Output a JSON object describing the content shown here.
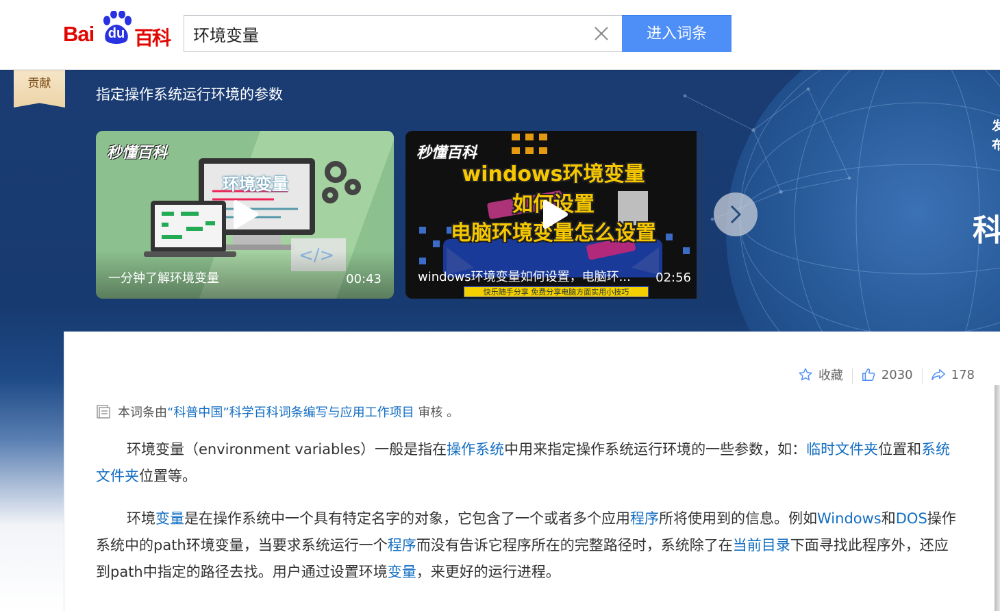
{
  "header": {
    "logo_text": "Bai du 百科",
    "search": {
      "value": "环境变量",
      "placeholder": ""
    },
    "enter_label": "进入词条"
  },
  "hero": {
    "contrib_label": "贡献",
    "subtitle": "指定操作系统运行环境的参数",
    "side_text": [
      "发",
      "布",
      "科"
    ],
    "videos": [
      {
        "brand": "秒懂百科",
        "thumb_text": "环境变量",
        "title": "一分钟了解环境变量",
        "duration": "00:43"
      },
      {
        "brand": "秒懂百科",
        "headline": [
          "windows环境变量",
          "如何设置",
          "电脑环境变量怎么设置"
        ],
        "banner": "快乐随手分享 免费分享电脑方面实用小技巧",
        "title": "windows环境变量如何设置，电脑环...",
        "duration": "02:56"
      }
    ]
  },
  "content": {
    "actions": {
      "favorite_label": "收藏",
      "likes": "2030",
      "shares": "178"
    },
    "review": {
      "prefix": "本词条由",
      "link": "“科普中国”科学百科词条编写与应用工作项目",
      "suffix": " 审核 。"
    },
    "paragraph1": {
      "t1": "环境变量（environment variables）一般是指在",
      "l1": "操作系统",
      "t2": "中用来指定操作系统运行环境的一些参数，如：",
      "l2": "临时文件夹",
      "t3": "位置和",
      "l3": "系统文件夹",
      "t4": "位置等。"
    },
    "paragraph2": {
      "t1": "环境",
      "l1": "变量",
      "t2": "是在操作系统中一个具有特定名字的对象，它包含了一个或者多个应用",
      "l2": "程序",
      "t3": "所将使用到的信息。例如",
      "l3": "Windows",
      "t4": "和",
      "l4": "DOS",
      "t5": "操作系统中的path环境变量，当要求系统运行一个",
      "l5": "程序",
      "t6": "而没有告诉它程序所在的完整路径时，系统除了在",
      "l6": "当前目录",
      "t7": "下面寻找此程序外，还应到path中指定的路径去找。用户通过设置环境",
      "l7": "变量",
      "t8": "，来更好的运行进程。"
    }
  },
  "colors": {
    "brand_red": "#e10601",
    "accent_blue": "#4e8ef7",
    "link": "#136ec2",
    "hero_bg": "#1b3d74"
  }
}
